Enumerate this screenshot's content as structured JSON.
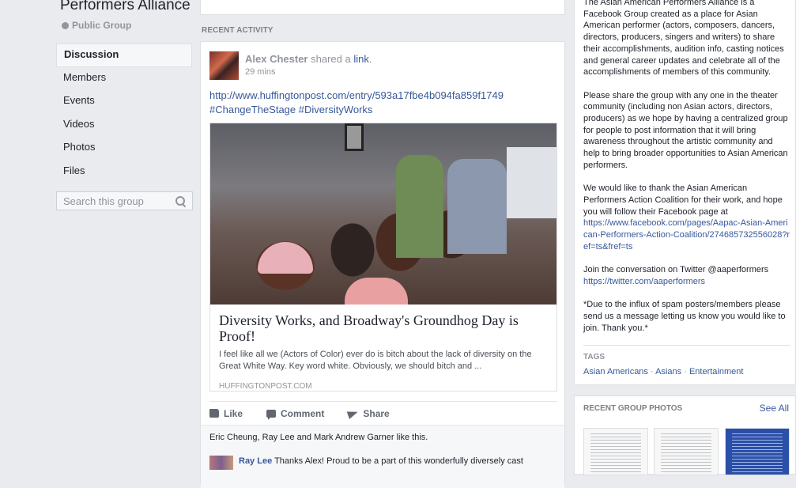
{
  "group": {
    "name": "Performers Alliance",
    "privacy": "Public Group"
  },
  "leftnav": {
    "items": [
      {
        "label": "Discussion",
        "active": true
      },
      {
        "label": "Members"
      },
      {
        "label": "Events"
      },
      {
        "label": "Videos"
      },
      {
        "label": "Photos"
      },
      {
        "label": "Files"
      }
    ],
    "search_placeholder": "Search this group"
  },
  "feed": {
    "section_title": "RECENT ACTIVITY",
    "post": {
      "author": "Alex Chester",
      "action": "shared a",
      "link_word": "link",
      "timestamp": "29 mins",
      "url": "http://www.huffingtonpost.com/entry/593a17fbe4b094fa859f1749",
      "hashtags": "#ChangeTheStage #DiversityWorks",
      "preview": {
        "title": "Diversity Works, and Broadway's Groundhog Day is Proof!",
        "description": "I feel like all we (Actors of Color) ever do is bitch about the lack of diversity on the Great White Way. Key word white. Obviously, we should bitch and ...",
        "source": "HUFFINGTONPOST.COM"
      },
      "actions": {
        "like": "Like",
        "comment": "Comment",
        "share": "Share"
      },
      "likes_summary": "Eric Cheung, Ray Lee and Mark Andrew Garner like this.",
      "comment": {
        "author": "Ray Lee",
        "text": "Thanks Alex! Proud to be a part of this wonderfully diversely cast"
      }
    }
  },
  "about": {
    "p1": "The Asian American Performers Alliance is a Facebook Group created as a place for Asian American performer (actors, composers, dancers, directors, producers, singers and writers) to share their accomplishments, audition info, casting notices and general career updates and celebrate all of the accomplishments of members of this community.",
    "p2": "Please share the group with any one in the theater community (including non Asian actors, directors, producers) as we hope by having a centralized group for people to post information that it will bring awareness throughout the artistic community and help to bring broader opportunities to Asian American performers.",
    "p3_text": "We would like to thank the Asian American Performers Action Coalition for their work, and hope you will follow their Facebook page at",
    "p3_link": "https://www.facebook.com/pages/Aapac-Asian-American-Performers-Action-Coalition/274685732556028?ref=ts&fref=ts",
    "p4_text": "Join the conversation on Twitter @aaperformers",
    "p4_link": "https://twitter.com/aaperformers",
    "p5": "*Due to the influx of spam posters/members please send us a message letting us know you would like to join. Thank you.*",
    "tags_title": "TAGS",
    "tags": [
      "Asian Americans",
      "Asians",
      "Entertainment"
    ],
    "tag_separator": "·"
  },
  "photos": {
    "title": "RECENT GROUP PHOTOS",
    "see_all": "See All"
  }
}
